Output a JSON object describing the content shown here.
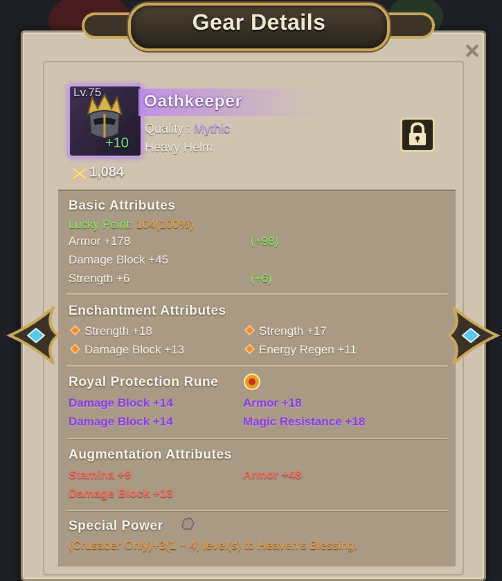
{
  "dialog": {
    "title": "Gear Details",
    "close_label": "×"
  },
  "item": {
    "level": "Lv.75",
    "enhance": "+10",
    "name": "Oathkeeper",
    "quality_label": "Quality : ",
    "quality_value": "Mythic",
    "type": "Heavy Helm",
    "power": "1,084",
    "icon": "helm-icon",
    "locked": true
  },
  "basic": {
    "title": "Basic Attributes",
    "lucky_label": "Lucky Point:",
    "lucky_value": "104(100%)",
    "rows": [
      {
        "label": "Armor +178",
        "bonus": "(+98)"
      },
      {
        "label": "Damage Block +45",
        "bonus": ""
      },
      {
        "label": "Strength +6",
        "bonus": "(+6)"
      }
    ]
  },
  "enchant": {
    "title": "Enchantment Attributes",
    "items": [
      "Strength +18",
      "Strength +17",
      "Damage Block +13",
      "Energy Regen +11"
    ]
  },
  "rune": {
    "title": "Royal Protection Rune",
    "items": [
      "Damage Block +14",
      "Armor +18",
      "Damage Block +14",
      "Magic Resistance +18"
    ]
  },
  "augment": {
    "title": "Augmentation Attributes",
    "items": [
      "Stamina +9",
      "Armor +48",
      "Damage Block +18"
    ]
  },
  "special": {
    "title": "Special Power",
    "text": "(Crusader Only)+3(1 ~ 4) level(s) to Heaven's Blessing."
  },
  "colors": {
    "panel": "#cfc4b1",
    "gold_frame": "#c8a85a",
    "mythic": "#c79ee8",
    "green": "#8df05a",
    "orange": "#f1a046",
    "purple": "#8a3ae0",
    "salmon": "#ef7160"
  }
}
